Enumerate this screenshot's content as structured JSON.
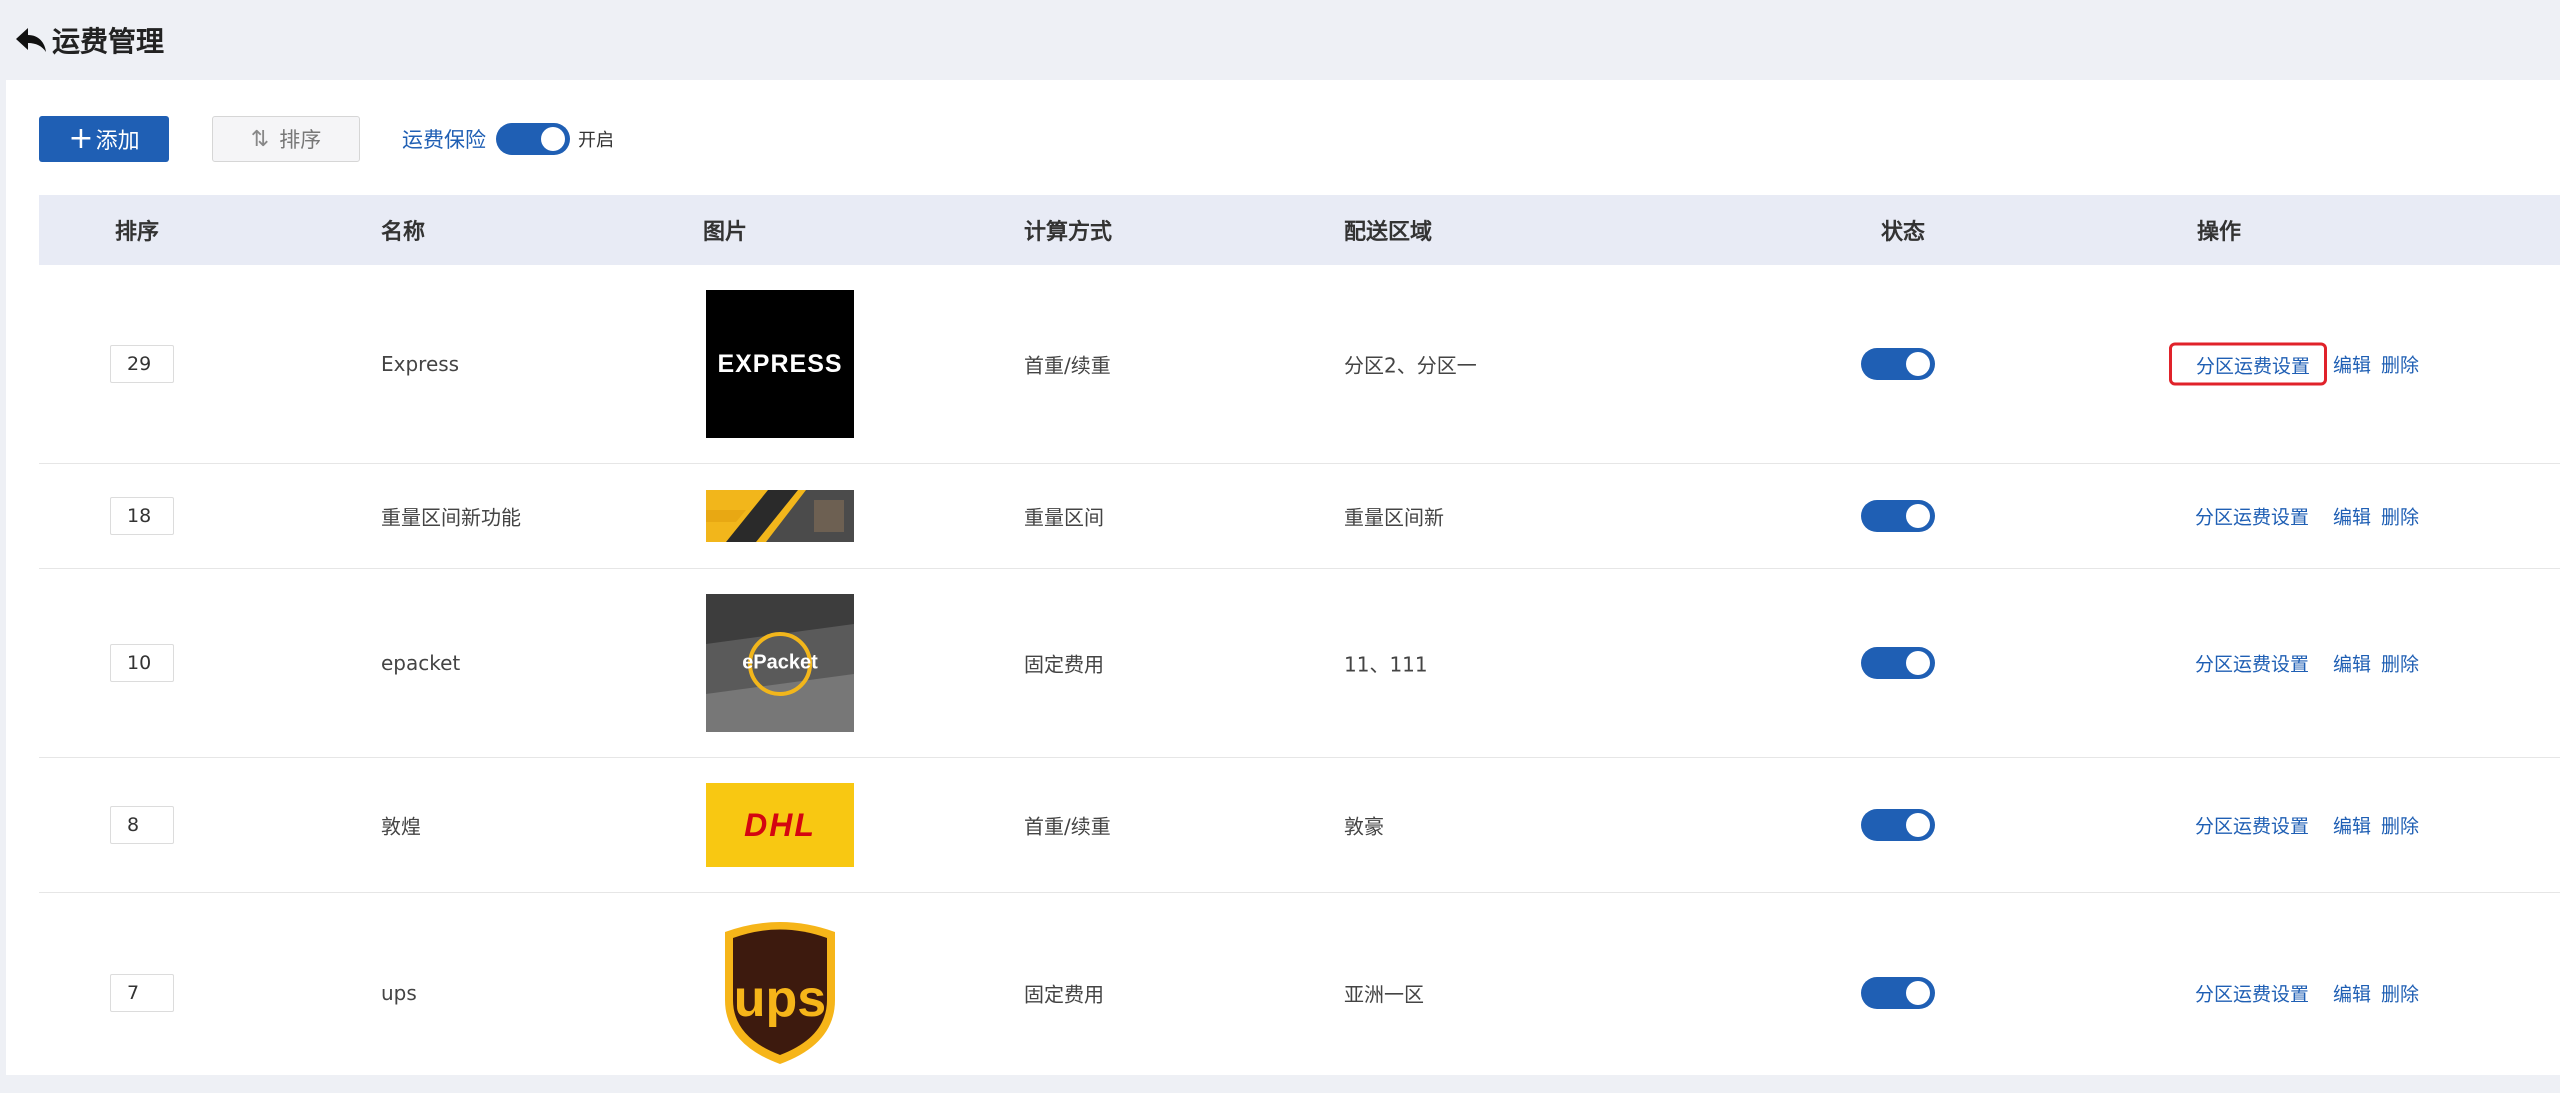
{
  "header": {
    "title": "运费管理"
  },
  "toolbar": {
    "add_label": "添加",
    "sort_label": "排序",
    "insurance_label": "运费保险",
    "insurance_state": "开启"
  },
  "table": {
    "columns": [
      "排序",
      "名称",
      "图片",
      "计算方式",
      "配送区域",
      "状态",
      "操作"
    ],
    "rows": [
      {
        "order": "29",
        "name": "Express",
        "image": "express-logo",
        "logo_text": "EXPRESS",
        "method": "首重/续重",
        "area": "分区2、分区一",
        "enabled": true
      },
      {
        "order": "18",
        "name": "重量区间新功能",
        "image": "banner-image",
        "logo_text": "",
        "method": "重量区间",
        "area": "重量区间新",
        "enabled": true
      },
      {
        "order": "10",
        "name": "epacket",
        "image": "epacket-logo",
        "logo_text": "ePacket",
        "method": "固定费用",
        "area": "11、111",
        "enabled": true
      },
      {
        "order": "8",
        "name": "敦煌",
        "image": "dhl-logo",
        "logo_text": "DHL",
        "method": "首重/续重",
        "area": "敦豪",
        "enabled": true
      },
      {
        "order": "7",
        "name": "ups",
        "image": "ups-logo",
        "logo_text": "ups",
        "method": "固定费用",
        "area": "亚洲一区",
        "enabled": true
      }
    ],
    "actions": {
      "zone": "分区运费设置",
      "edit": "编辑",
      "delete": "删除"
    }
  },
  "colors": {
    "primary": "#1f5fb4",
    "header_bg": "#eef0f5",
    "table_head_bg": "#e8ebf5",
    "highlight": "#e0222a"
  }
}
